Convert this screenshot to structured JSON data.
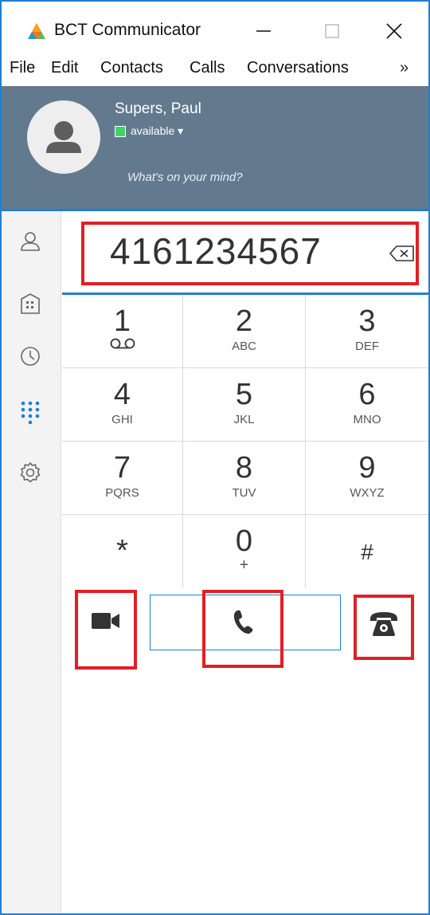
{
  "window": {
    "title": "BCT Communicator"
  },
  "menu": {
    "items": [
      {
        "label": "File"
      },
      {
        "label": "Edit"
      },
      {
        "label": "Contacts"
      },
      {
        "label": "Calls"
      },
      {
        "label": "Conversations"
      }
    ],
    "more_label": "»"
  },
  "profile": {
    "name": "Supers, Paul",
    "status": "available ▾",
    "mood_placeholder": "What's on your mind?",
    "status_color": "#3fd46a"
  },
  "nav": {
    "items": [
      "contacts-icon",
      "directory-icon",
      "history-icon",
      "dialpad-icon",
      "settings-icon"
    ],
    "active": "dialpad-icon"
  },
  "dialer": {
    "number": "4161234567",
    "keys": [
      {
        "digit": "1",
        "letters": ""
      },
      {
        "digit": "2",
        "letters": "ABC"
      },
      {
        "digit": "3",
        "letters": "DEF"
      },
      {
        "digit": "4",
        "letters": "GHI"
      },
      {
        "digit": "5",
        "letters": "JKL"
      },
      {
        "digit": "6",
        "letters": "MNO"
      },
      {
        "digit": "7",
        "letters": "PQRS"
      },
      {
        "digit": "8",
        "letters": "TUV"
      },
      {
        "digit": "9",
        "letters": "WXYZ"
      },
      {
        "digit": "*",
        "letters": ""
      },
      {
        "digit": "0",
        "letters": "+"
      },
      {
        "digit": "#",
        "letters": ""
      }
    ]
  },
  "actions": {
    "video_icon": "video-camera-icon",
    "call_icon": "phone-handset-icon",
    "desk_phone_icon": "desk-phone-icon"
  },
  "colors": {
    "accent": "#1e7fd8",
    "highlight": "#e11f26",
    "profile_bg": "#637a8e"
  }
}
